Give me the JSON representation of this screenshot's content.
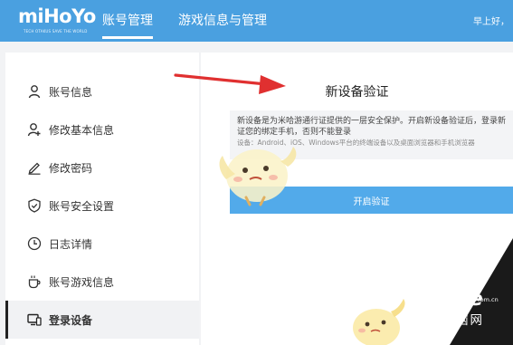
{
  "header": {
    "logo_text": "miHoYo",
    "logo_tagline": "TECH OTAKUS SAVE THE WORLD",
    "tabs": [
      {
        "label": "账号管理",
        "active": true
      },
      {
        "label": "游戏信息与管理",
        "active": false
      }
    ],
    "greeting": "早上好，"
  },
  "sidebar": {
    "items": [
      {
        "label": "账号信息",
        "icon": "user-icon",
        "active": false
      },
      {
        "label": "修改基本信息",
        "icon": "user-edit-icon",
        "active": false
      },
      {
        "label": "修改密码",
        "icon": "pencil-icon",
        "active": false
      },
      {
        "label": "账号安全设置",
        "icon": "shield-icon",
        "active": false
      },
      {
        "label": "日志详情",
        "icon": "clock-icon",
        "active": false
      },
      {
        "label": "账号游戏信息",
        "icon": "cup-icon",
        "active": false
      },
      {
        "label": "登录设备",
        "icon": "devices-icon",
        "active": true
      }
    ]
  },
  "main": {
    "title": "新设备验证",
    "notice_line1": "新设备是为米哈游通行证提供的一层安全保护。开启新设备验证后，登录新",
    "notice_line2": "证您的绑定手机，否则不能登录",
    "notice_line3": "设备：Android、iOS、Windows平台的终端设备以及桌面浏览器和手机浏览器",
    "enable_button": "开启验证"
  },
  "overlay": {
    "watermark_main": "PConline",
    "watermark_domain": ".com.cn",
    "watermark_cn": "太平洋电脑网"
  },
  "colors": {
    "header_bg": "#4aa0e0",
    "button_bg": "#52aaea",
    "arrow": "#e03030"
  }
}
